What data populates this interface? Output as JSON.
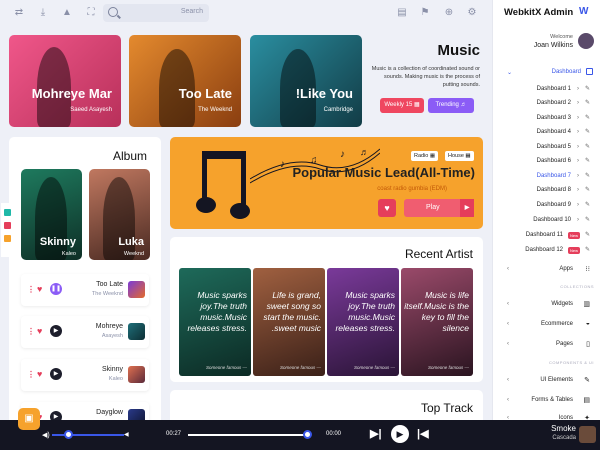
{
  "search": {
    "placeholder": "Search"
  },
  "featured_cards": [
    {
      "title": "Mohreye Mar",
      "artist": "Saeed Asayesh",
      "color": "#e04a6e"
    },
    {
      "title": "Too Late",
      "artist": "The Weeknd",
      "color": "#c0641c"
    },
    {
      "title": "!Like You",
      "artist": "Cambridge",
      "color": "#1f6f7a"
    }
  ],
  "music": {
    "title": "Music",
    "description": "Music is a collection of coordinated sound or sounds. Making music is the process of putting sounds.",
    "weekly_label": "Weekly 15 ▦",
    "trending_label": "Trending ♬"
  },
  "album": {
    "title": "Album",
    "cards": [
      {
        "title": "Skinny",
        "artist": "Kaleo"
      },
      {
        "title": "Luka",
        "artist": "Weeknd"
      }
    ],
    "tracks": [
      {
        "title": "Too Late",
        "artist": "The Weeknd"
      },
      {
        "title": "Mohreye",
        "artist": "Asayesh"
      },
      {
        "title": "Skinny",
        "artist": "Kaleo"
      },
      {
        "title": "Dayglow",
        "artist": ""
      }
    ]
  },
  "popular": {
    "tag_radio": "Radio ▦",
    "tag_house": "House ▦",
    "title": "Popular Music Lead(All-Time)",
    "subtitle": "coast radio gumbia (EDM)",
    "play_label": "Play"
  },
  "recent_artist": {
    "title": "Recent Artist",
    "cards": [
      {
        "quote": "Music sparks joy.The truth music.Music releases stress.",
        "author": "Someone famous —"
      },
      {
        "quote": "Life is grand, sweet song so start the music. .sweet music",
        "author": "Someone famous —"
      },
      {
        "quote": "Music sparks joy.The truth music.Music releases stress.",
        "author": "Someone famous —"
      },
      {
        "quote": "Music is life itself.Music is the key to fill the silence",
        "author": "Someone famous —"
      }
    ]
  },
  "top_track": {
    "title": "Top Track"
  },
  "sidebar": {
    "brand": "WebkitX Admin",
    "welcome": "Welcome",
    "user_name": "Joan Wilkins",
    "dashboard_head": "Dashboard",
    "items": [
      {
        "label": "Dashboard 1"
      },
      {
        "label": "Dashboard 2"
      },
      {
        "label": "Dashboard 3"
      },
      {
        "label": "Dashboard 4"
      },
      {
        "label": "Dashboard 5"
      },
      {
        "label": "Dashboard 6"
      },
      {
        "label": "Dashboard 7"
      },
      {
        "label": "Dashboard 8"
      },
      {
        "label": "Dashboard 9"
      },
      {
        "label": "Dashboard 10"
      },
      {
        "label": "Dashboard 11"
      },
      {
        "label": "Dashboard 12"
      }
    ],
    "new_badge": "New",
    "apps": "Apps",
    "collections_label": "COLLECTIONS",
    "widgets": "Widgets",
    "ecommerce": "Ecommerce",
    "pages": "Pages",
    "components_label": "COMPONENTS & UI",
    "ui_elements": "UI Elements",
    "forms_tables": "Forms & Tables",
    "icons": "Icons"
  },
  "player": {
    "current_time": "00:27",
    "end_time": "00:00",
    "song": "Smoke",
    "artist": "Cascada",
    "progress": 0.96,
    "volume": 0.2
  }
}
